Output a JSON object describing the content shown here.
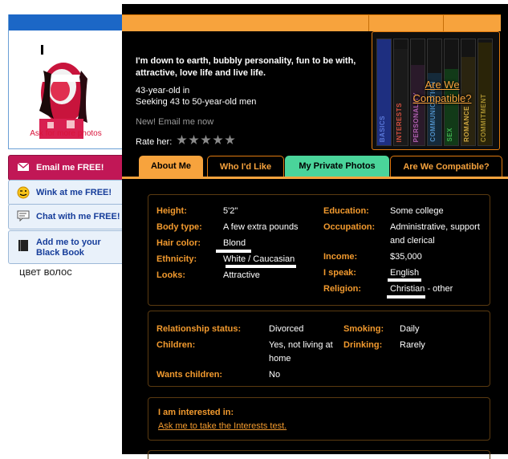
{
  "sidebar": {
    "ask_photos": "Ask for more photos",
    "email_me": "Email me FREE!",
    "wink_at_me": "Wink at me FREE!",
    "chat_with_me": "Chat with me FREE!",
    "black_book_line1": "Add me to your",
    "black_book_line2": "Black Book",
    "annotation_ru": "цвет волос"
  },
  "profile": {
    "intro": "I'm down to earth, bubbly personality, fun to be with, attractive, love life and live life.",
    "age_line": "43-year-old in",
    "seeking_line": "Seeking 43 to 50-year-old men",
    "email_now": "New! Email me now",
    "rate_label": "Rate her:",
    "rating": 0
  },
  "compat_widget": {
    "question_line1": "Are We",
    "question_line2": "Compatible?",
    "bars": [
      {
        "label": "BASICS",
        "color": "#2a3f9a"
      },
      {
        "label": "INTERESTS",
        "color": "#b4362a"
      },
      {
        "label": "PERSONALITY",
        "color": "#8a3a8a"
      },
      {
        "label": "COMMUNICATION",
        "color": "#2e6aa0"
      },
      {
        "label": "SEX",
        "color": "#2e8a3c"
      },
      {
        "label": "ROMANCE",
        "color": "#c49a2a"
      },
      {
        "label": "COMMITMENT",
        "color": "#7a6a1a"
      }
    ]
  },
  "tabs": {
    "about_me": "About Me",
    "who_id_like": "Who I'd Like",
    "private_photos": "My Private Photos",
    "are_we_compatible": "Are We Compatible?"
  },
  "details": {
    "height_label": "Height:",
    "height": "5'2\"",
    "body_label": "Body type:",
    "body": "A few extra pounds",
    "hair_label": "Hair color:",
    "hair": "Blond",
    "ethnicity_label": "Ethnicity:",
    "ethnicity": "White / Caucasian",
    "looks_label": "Looks:",
    "looks": "Attractive",
    "education_label": "Education:",
    "education": "Some college",
    "occupation_label": "Occupation:",
    "occupation_line1": "Administrative, support",
    "occupation_line2": "and clerical",
    "income_label": "Income:",
    "income": "$35,000",
    "speak_label": "I speak:",
    "speak": "English",
    "religion_label": "Religion:",
    "religion": "Christian - other"
  },
  "lifestyle": {
    "relationship_label": "Relationship status:",
    "relationship": "Divorced",
    "children_label": "Children:",
    "children_line1": "Yes, not living at",
    "children_line2": "home",
    "wants_children_label": "Wants children:",
    "wants_children": "No",
    "smoking_label": "Smoking:",
    "smoking": "Daily",
    "drinking_label": "Drinking:",
    "drinking": "Rarely"
  },
  "interests": {
    "heading": "I am interested in:",
    "link": "Ask me to take the Interests test."
  },
  "colors": {
    "accent_orange": "#f7a33d",
    "tab_green": "#4ad49a",
    "email_button": "#c11756",
    "panel_bg": "#000000"
  }
}
